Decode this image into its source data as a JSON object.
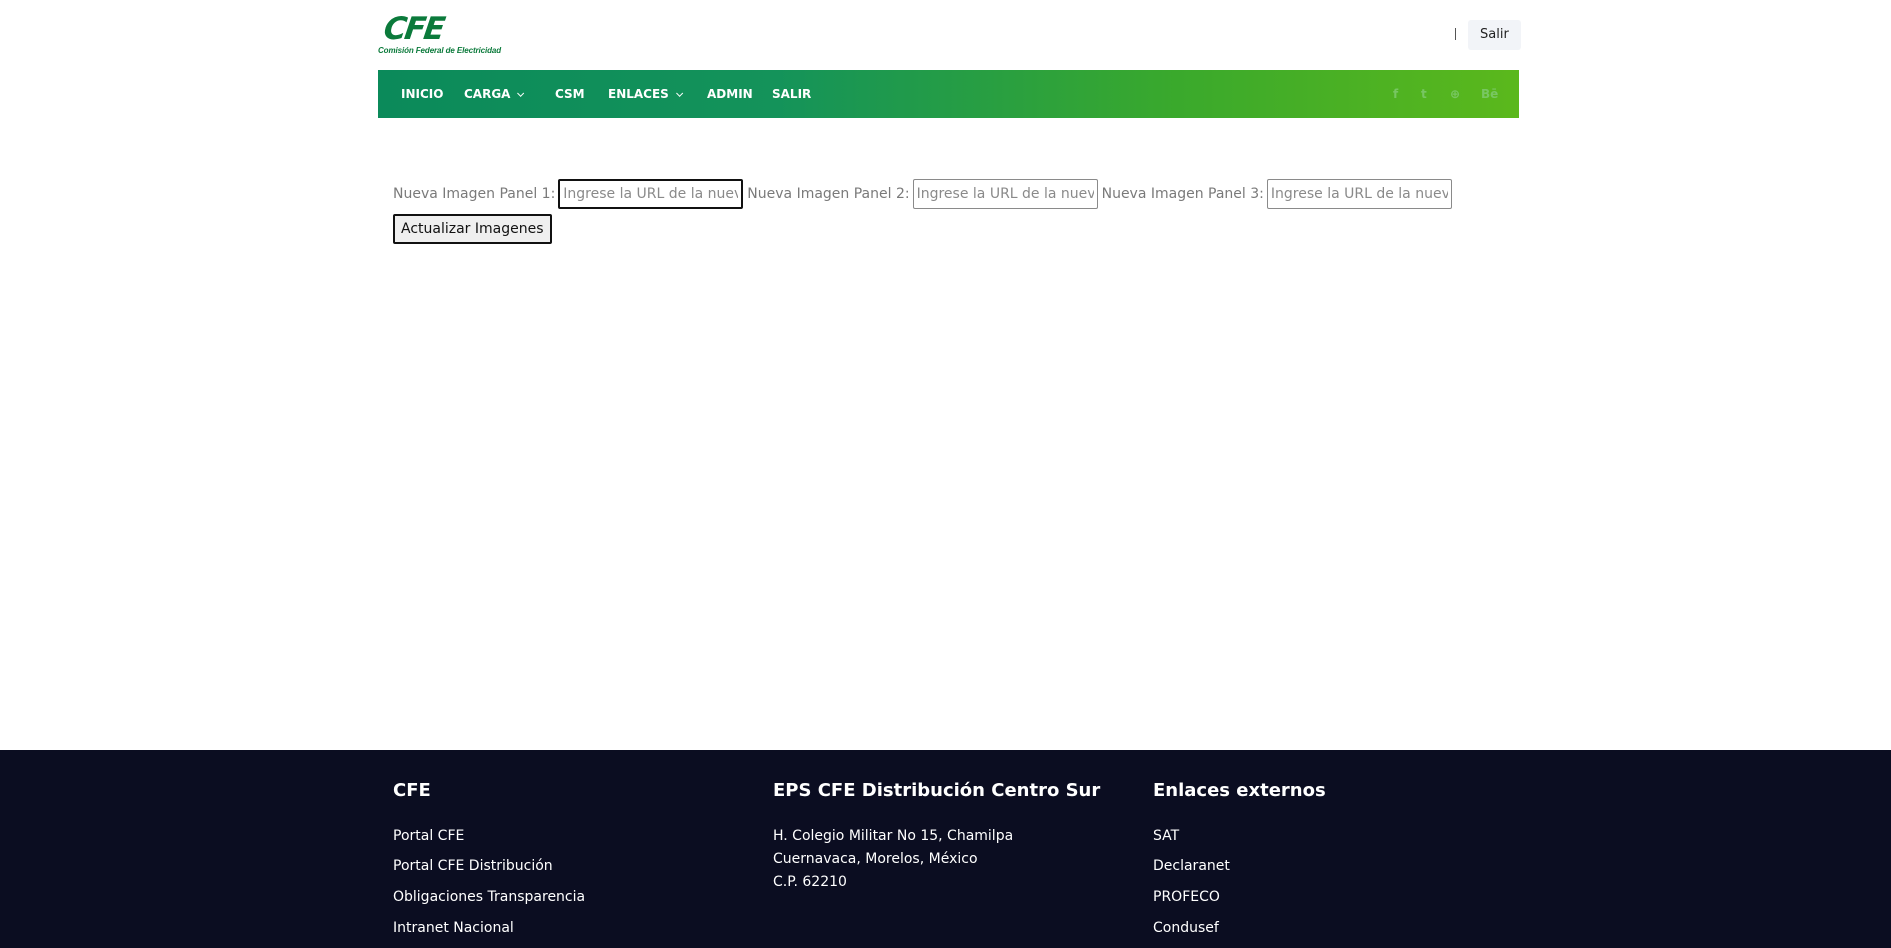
{
  "header": {
    "logo_text": "CFE",
    "logo_subtitle": "Comisión Federal de Electricidad",
    "separator": "|",
    "logout_label": "Salir"
  },
  "nav": {
    "items": [
      {
        "label": "INICIO",
        "dropdown": false
      },
      {
        "label": "CARGA",
        "dropdown": true
      },
      {
        "label": "CSM",
        "dropdown": false
      },
      {
        "label": "ENLACES",
        "dropdown": true
      },
      {
        "label": "ADMIN",
        "dropdown": false
      },
      {
        "label": "SALIR",
        "dropdown": false
      }
    ],
    "social": [
      {
        "icon": "facebook-icon",
        "glyph": "f"
      },
      {
        "icon": "twitter-icon",
        "glyph": "t"
      },
      {
        "icon": "dribbble-icon",
        "glyph": "⊕"
      },
      {
        "icon": "behance-icon",
        "glyph": "Bē"
      }
    ]
  },
  "form": {
    "panel1_label": "Nueva Imagen Panel 1:",
    "panel2_label": "Nueva Imagen Panel 2:",
    "panel3_label": "Nueva Imagen Panel 3:",
    "placeholder": "Ingrese la URL de la nueva imagen",
    "panel1_value": "",
    "panel2_value": "",
    "panel3_value": "",
    "submit_label": "Actualizar Imagenes"
  },
  "footer": {
    "col1": {
      "title": "CFE",
      "links": [
        "Portal CFE",
        "Portal CFE Distribución",
        "Obligaciones Transparencia",
        "Intranet Nacional"
      ]
    },
    "col2": {
      "title": "EPS CFE Distribución Centro Sur",
      "address": [
        "H. Colegio Militar No 15, Chamilpa",
        "Cuernavaca, Morelos, México",
        "C.P. 62210"
      ]
    },
    "col3": {
      "title": "Enlaces externos",
      "links": [
        "SAT",
        "Declaranet",
        "PROFECO",
        "Condusef"
      ]
    }
  }
}
